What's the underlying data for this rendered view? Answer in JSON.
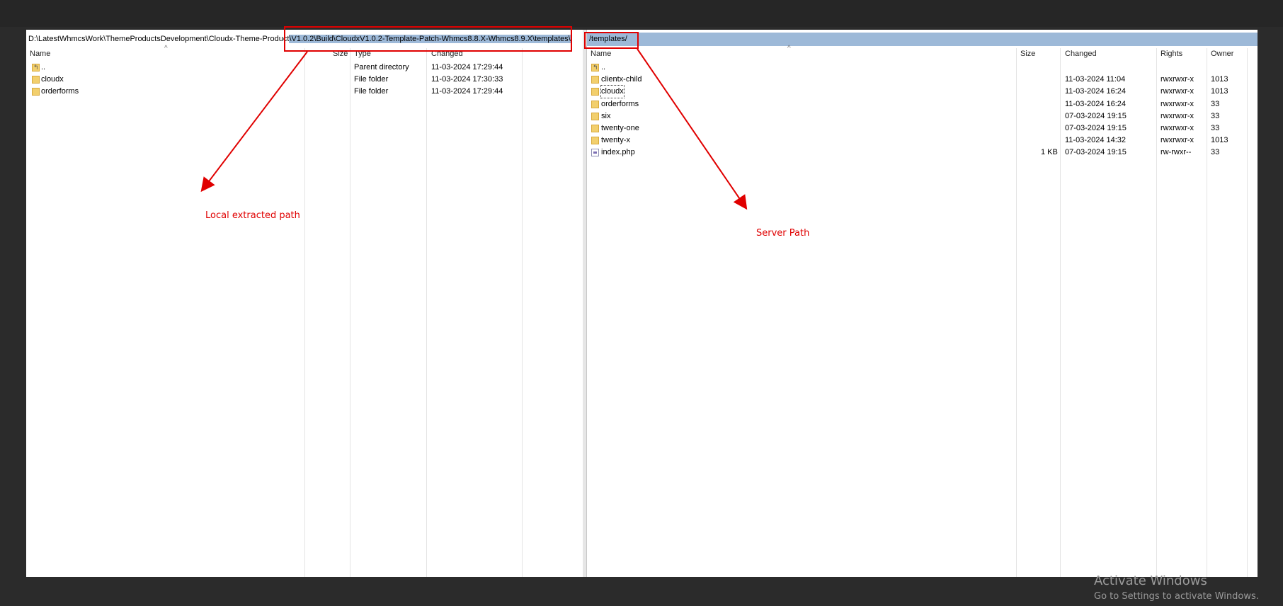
{
  "local": {
    "path_prefix": "D:\\LatestWhmcsWork\\ThemeProductsDevelopment\\Cloudx-Theme-Product",
    "path_selected": "\\V1.0.2\\Build\\CloudxV1.0.2-Template-Patch-Whmcs8.8.X-Whmcs8.9.X\\templates\\",
    "columns": {
      "name": "Name",
      "size": "Size",
      "type": "Type",
      "changed": "Changed"
    },
    "rows": [
      {
        "name": "..",
        "size": "",
        "type": "Parent directory",
        "changed": "11-03-2024 17:29:44",
        "icon": "parent-folder-icon"
      },
      {
        "name": "cloudx",
        "size": "",
        "type": "File folder",
        "changed": "11-03-2024 17:30:33",
        "icon": "folder-icon"
      },
      {
        "name": "orderforms",
        "size": "",
        "type": "File folder",
        "changed": "11-03-2024 17:29:44",
        "icon": "folder-icon"
      }
    ]
  },
  "remote": {
    "path": "/templates/",
    "columns": {
      "name": "Name",
      "size": "Size",
      "changed": "Changed",
      "rights": "Rights",
      "owner": "Owner"
    },
    "rows": [
      {
        "name": "..",
        "size": "",
        "changed": "",
        "rights": "",
        "owner": "",
        "icon": "parent-folder-icon"
      },
      {
        "name": "clientx-child",
        "size": "",
        "changed": "11-03-2024 11:04",
        "rights": "rwxrwxr-x",
        "owner": "1013",
        "icon": "folder-icon"
      },
      {
        "name": "cloudx",
        "size": "",
        "changed": "11-03-2024 16:24",
        "rights": "rwxrwxr-x",
        "owner": "1013",
        "icon": "folder-icon"
      },
      {
        "name": "orderforms",
        "size": "",
        "changed": "11-03-2024 16:24",
        "rights": "rwxrwxr-x",
        "owner": "33",
        "icon": "folder-icon"
      },
      {
        "name": "six",
        "size": "",
        "changed": "07-03-2024 19:15",
        "rights": "rwxrwxr-x",
        "owner": "33",
        "icon": "folder-icon"
      },
      {
        "name": "twenty-one",
        "size": "",
        "changed": "07-03-2024 19:15",
        "rights": "rwxrwxr-x",
        "owner": "33",
        "icon": "folder-icon"
      },
      {
        "name": "twenty-x",
        "size": "",
        "changed": "11-03-2024 14:32",
        "rights": "rwxrwxr-x",
        "owner": "1013",
        "icon": "folder-icon"
      },
      {
        "name": "index.php",
        "size": "1 KB",
        "changed": "07-03-2024 19:15",
        "rights": "rw-rwxr--",
        "owner": "33",
        "icon": "file-icon"
      }
    ]
  },
  "annotations": {
    "local_label": "Local extracted path",
    "server_label": "Server Path",
    "color": "#e00000"
  },
  "watermark": {
    "title": "Activate Windows",
    "subtitle": "Go to Settings to activate Windows."
  },
  "colors": {
    "path_highlight": "#9db9d8",
    "folder": "#f2cf6d"
  }
}
